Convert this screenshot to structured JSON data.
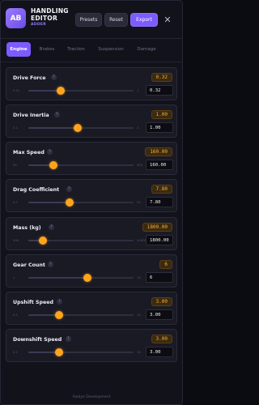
{
  "header": {
    "logo": "AB",
    "title": "HANDLING EDITOR",
    "subtitle": "ADDER",
    "presets_label": "Presets",
    "reset_label": "Reset",
    "export_label": "Export",
    "close_icon": "close-icon"
  },
  "tabs": [
    {
      "label": "Engine",
      "active": true
    },
    {
      "label": "Brakes",
      "active": false
    },
    {
      "label": "Traction",
      "active": false
    },
    {
      "label": "Suspension",
      "active": false
    },
    {
      "label": "Damage",
      "active": false
    }
  ],
  "fields": [
    {
      "label": "Drive Force",
      "value": "0.32",
      "min": "0.01",
      "max": "1",
      "input": "0.32",
      "level": 0.31
    },
    {
      "label": "Drive Inertia",
      "value": "1.00",
      "min": "0.1",
      "max": "2",
      "input": "1.00",
      "level": 0.47
    },
    {
      "label": "Max Speed",
      "value": "160.00",
      "min": "50",
      "max": "500",
      "input": "160.00",
      "level": 0.24
    },
    {
      "label": "Drag Coefficient",
      "value": "7.80",
      "min": "0.1",
      "max": "20",
      "input": "7.80",
      "level": 0.39
    },
    {
      "label": "Mass (kg)",
      "value": "1800.00",
      "min": "500",
      "max": "10000",
      "input": "1800.00",
      "level": 0.14
    },
    {
      "label": "Gear Count",
      "value": "6",
      "min": "1",
      "max": "10",
      "input": "6",
      "level": 0.56
    },
    {
      "label": "Upshift Speed",
      "value": "3.00",
      "min": "0.1",
      "max": "10",
      "input": "3.00",
      "level": 0.29
    },
    {
      "label": "Downshift Speed",
      "value": "3.00",
      "min": "0.1",
      "max": "10",
      "input": "3.00",
      "level": 0.29
    }
  ],
  "help_icon": "?",
  "footer": "Ajebye Development",
  "colors": {
    "accent": "#7c5cff",
    "value": "#ffab2e",
    "thumb": "#ffa41b"
  }
}
